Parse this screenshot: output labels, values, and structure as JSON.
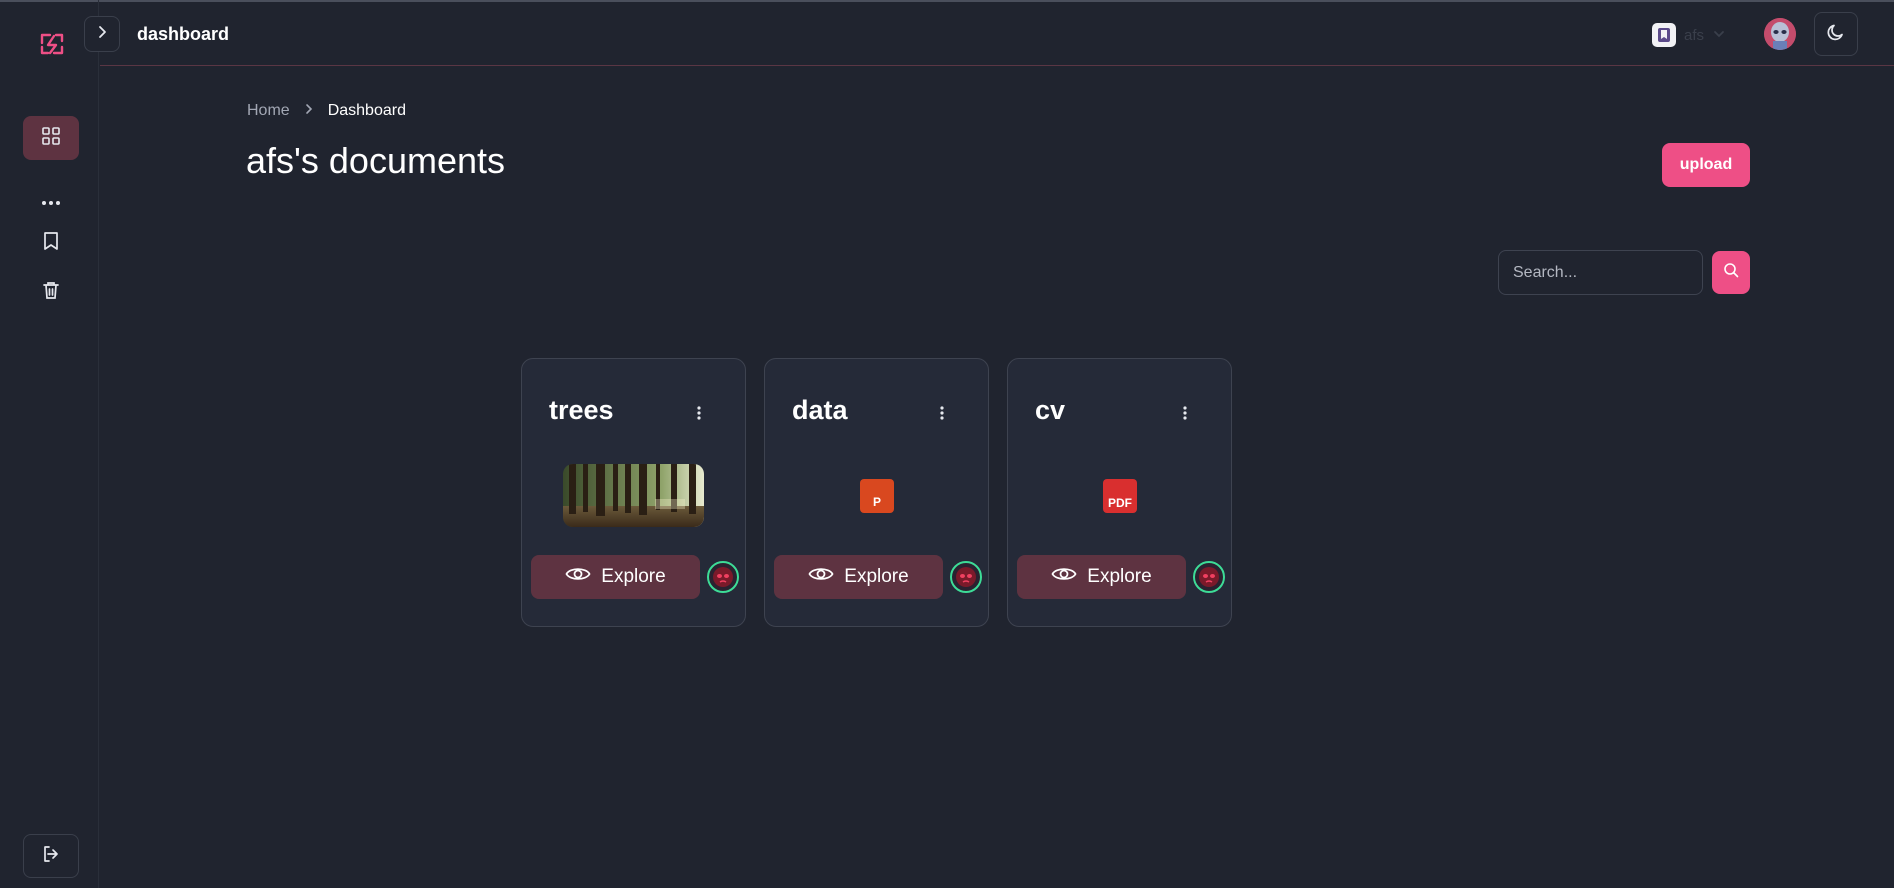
{
  "sidebar": {
    "logo_icon": "bolt-logo-icon",
    "items": [
      {
        "name": "dashboard",
        "icon": "grid-icon",
        "active": true
      },
      {
        "name": "more",
        "icon": "more-horizontal-icon"
      },
      {
        "name": "bookmarks",
        "icon": "bookmark-icon"
      },
      {
        "name": "trash",
        "icon": "trash-icon"
      }
    ],
    "logout_icon": "logout-icon"
  },
  "header": {
    "title": "dashboard",
    "org_name": "afs",
    "toggle_icon": "chevron-right-icon",
    "theme_icon": "moon-icon"
  },
  "breadcrumb": {
    "home": "Home",
    "current": "Dashboard"
  },
  "page": {
    "title": "afs's documents",
    "upload_label": "upload"
  },
  "search": {
    "placeholder": "Search...",
    "value": ""
  },
  "documents": [
    {
      "title": "trees",
      "type": "image",
      "explore_label": "Explore"
    },
    {
      "title": "data",
      "type": "pptx",
      "badge": "P",
      "explore_label": "Explore"
    },
    {
      "title": "cv",
      "type": "pdf",
      "badge": "PDF",
      "explore_label": "Explore"
    }
  ],
  "colors": {
    "background": "#20242f",
    "accent": "#ee4f86",
    "active_bg": "#5e3341",
    "card_bg": "#252a38",
    "pptx": "#d9481f",
    "pdf": "#d92f2f",
    "online": "#3ddc97"
  }
}
